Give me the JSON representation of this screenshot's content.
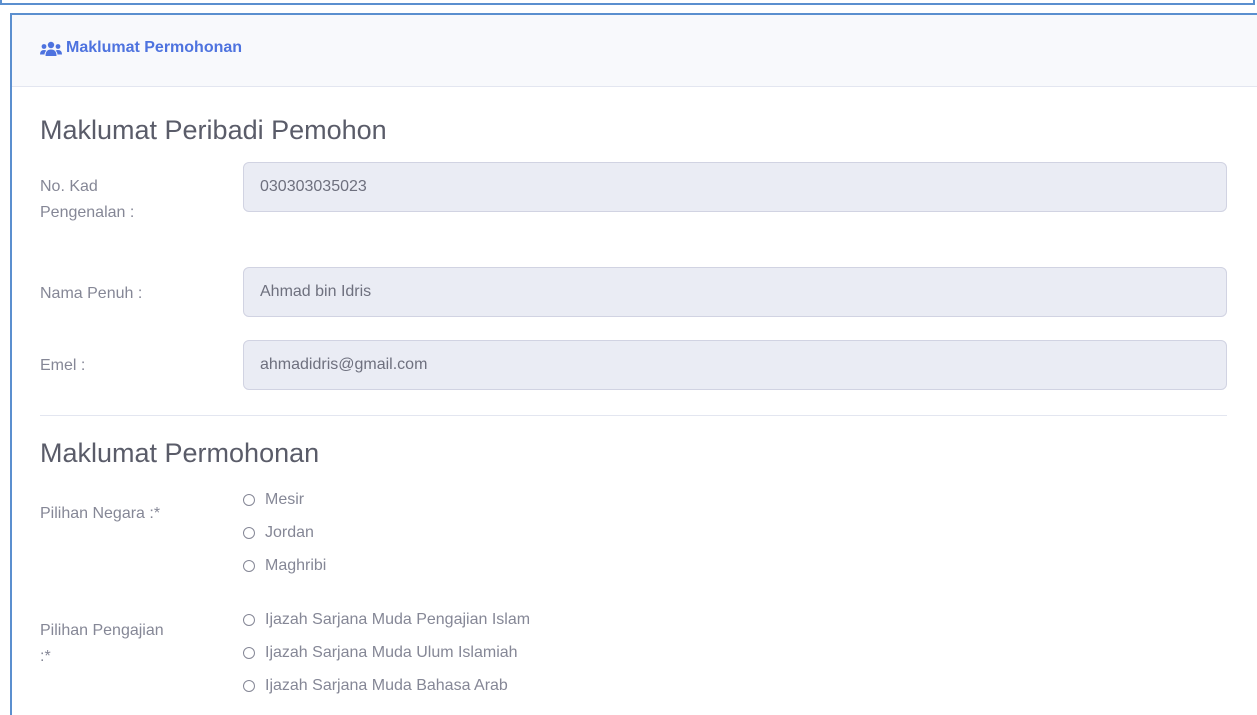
{
  "card": {
    "header_title": "Maklumat Permohonan",
    "header_icon": "users-icon",
    "accent_color": "#4e73df"
  },
  "personal": {
    "section_title": "Maklumat Peribadi Pemohon",
    "ic_label_line1": "No. Kad",
    "ic_label_line2": "Pengenalan :",
    "ic_value": "030303035023",
    "name_label": "Nama Penuh :",
    "name_value": "Ahmad bin Idris",
    "email_label": "Emel :",
    "email_value": "ahmadidris@gmail.com"
  },
  "application": {
    "section_title": "Maklumat Permohonan",
    "country_label": "Pilihan Negara :*",
    "country_options": [
      "Mesir",
      "Jordan",
      "Maghribi"
    ],
    "study_label_line1": "Pilihan Pengajian",
    "study_label_line2": ":*",
    "study_options": [
      "Ijazah Sarjana Muda Pengajian Islam",
      "Ijazah Sarjana Muda Ulum Islamiah",
      "Ijazah Sarjana Muda Bahasa Arab"
    ]
  }
}
